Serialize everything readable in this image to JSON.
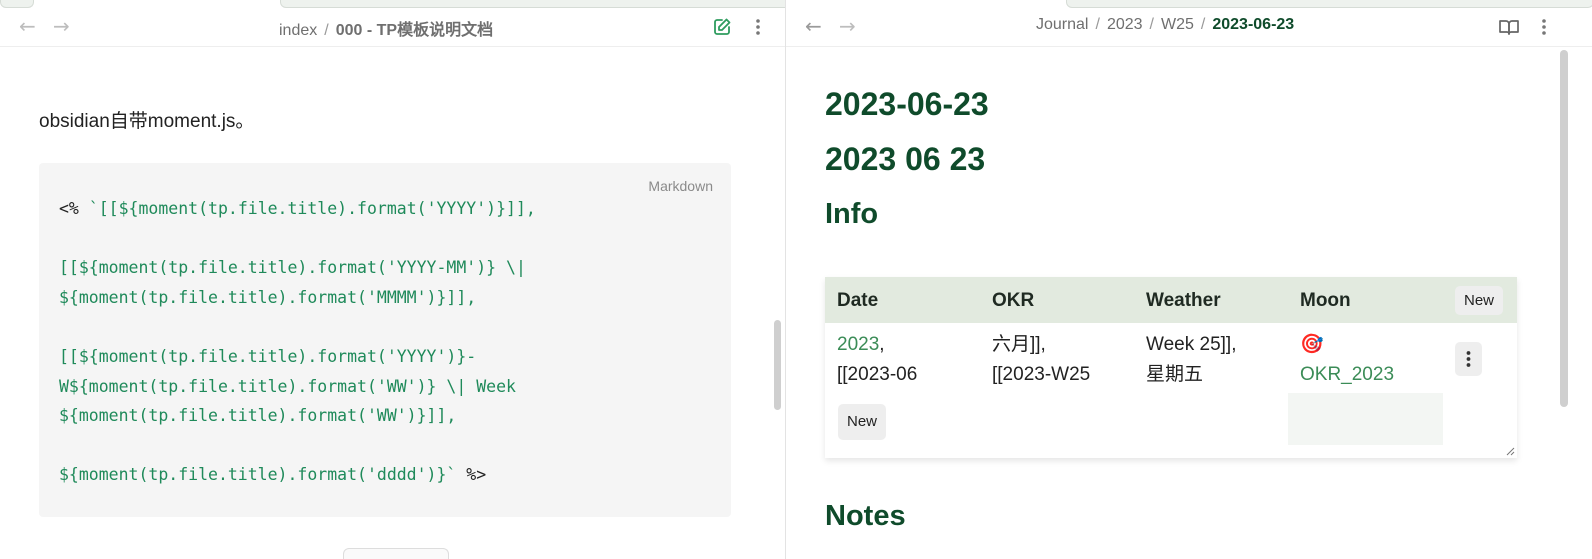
{
  "left_pane": {
    "breadcrumb": {
      "parent": "index",
      "separator": "/",
      "current": "000 - TP模板说明文档"
    },
    "paragraph": "obsidian自带moment.js。",
    "code_block": {
      "language": "Markdown",
      "lines": [
        [
          {
            "t": "<% ",
            "c": "d"
          },
          {
            "t": "`[[${moment(tp.file.title).format('YYYY')}]],",
            "c": "g"
          }
        ],
        [],
        [
          {
            "t": "[[${moment(tp.file.title).format('YYYY-MM')} \\|",
            "c": "g"
          }
        ],
        [
          {
            "t": "${moment(tp.file.title).format('MMMM')}]],",
            "c": "g"
          }
        ],
        [],
        [
          {
            "t": "[[${moment(tp.file.title).format('YYYY')}-",
            "c": "g"
          }
        ],
        [
          {
            "t": "W${moment(tp.file.title).format('WW')} \\| Week",
            "c": "g"
          }
        ],
        [
          {
            "t": "${moment(tp.file.title).format('WW')}]],",
            "c": "g"
          }
        ],
        [],
        [
          {
            "t": "${moment(tp.file.title).format('dddd')}`",
            "c": "g"
          },
          {
            "t": " %>",
            "c": "d"
          }
        ]
      ]
    }
  },
  "right_pane": {
    "breadcrumb": {
      "items": [
        "Journal",
        "2023",
        "W25"
      ],
      "separator": "/",
      "current": "2023-06-23"
    },
    "heading_1": "2023-06-23",
    "heading_2": "2023 06 23",
    "heading_info": "Info",
    "heading_notes": "Notes",
    "table": {
      "columns": [
        "Date",
        "OKR",
        "Weather",
        "Moon"
      ],
      "new_column_label": "New",
      "row": {
        "date_link": "2023",
        "date_after": ",",
        "date_line2": "[[2023-06",
        "okr_line1": "六月]],",
        "okr_line2": "[[2023-W25",
        "weather_line1": "Week 25]],",
        "weather_line2": "星期五",
        "moon_emoji": "🎯",
        "moon_link": "OKR_2023"
      },
      "new_row_label": "New",
      "row_menu_icon": "vertical-dots-icon"
    }
  },
  "colors": {
    "heading": "#0f4b2b",
    "link": "#3b8c57",
    "code_green": "#1f8a5a",
    "table_header_bg": "#e2eadf"
  }
}
